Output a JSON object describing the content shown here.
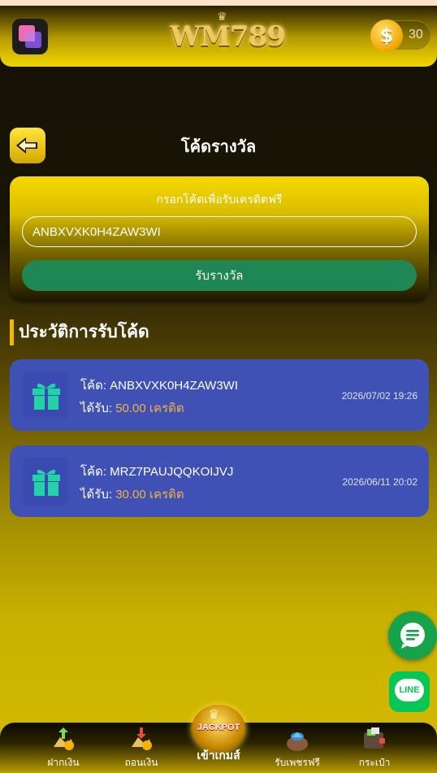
{
  "header": {
    "logo_text": "WM789",
    "coin_count": "30"
  },
  "page": {
    "title": "โค้ดรางวัล"
  },
  "redeem": {
    "label": "กรอกโค้ดเพื่อรับเครดิตฟรี",
    "code_value": "ANBXVXK0H4ZAW3WI",
    "button_label": "รับรางวัล"
  },
  "history": {
    "title": "ประวัติการรับโค้ด",
    "items": [
      {
        "code_prefix": "โค้ด:",
        "code": "ANBXVXK0H4ZAW3WI",
        "amount_prefix": "ได้รับ:",
        "amount": "50.00 เครดิต",
        "date": "2026/07/02 19:26"
      },
      {
        "code_prefix": "โค้ด:",
        "code": "MRZ7PAUJQQKOIJVJ",
        "amount_prefix": "ได้รับ:",
        "amount": "30.00 เครดิต",
        "date": "2026/06/11 20:02"
      }
    ]
  },
  "fab": {
    "line_label": "LINE"
  },
  "nav": {
    "deposit": "ฝากเงิน",
    "withdraw": "ถอนเงิน",
    "play": "เข้าเกมส์",
    "jackpot_text": "JACKPOT",
    "free_diamonds": "รับเพชรฟรี",
    "wallet": "กระเป๋า"
  },
  "colors": {
    "accent_yellow": "#f2d600",
    "card_blue": "#3f51b5",
    "button_green": "#1e8753",
    "amount_orange": "#f5b041",
    "gift_teal": "#22d3a5"
  }
}
